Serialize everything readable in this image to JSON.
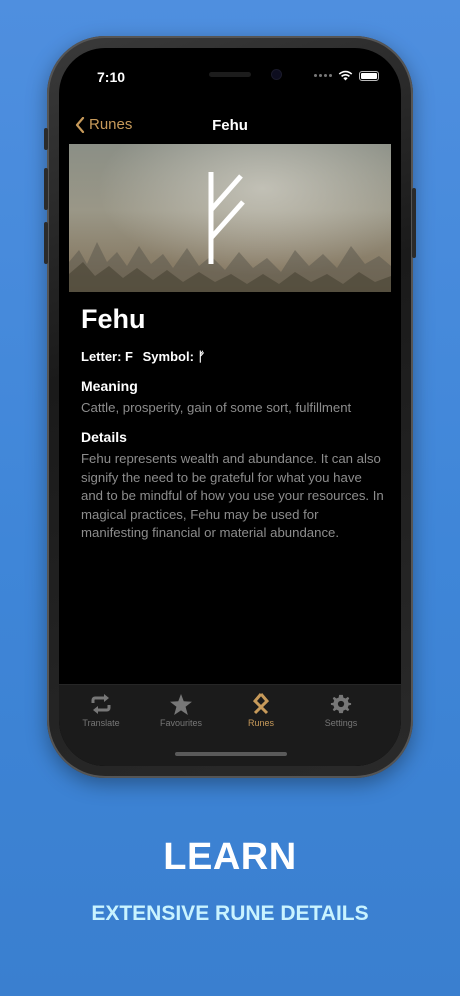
{
  "status": {
    "time": "7:10"
  },
  "nav": {
    "back_label": "Runes",
    "title": "Fehu"
  },
  "rune": {
    "name": "Fehu",
    "letter_label": "Letter: F",
    "symbol_label": "Symbol: ᚠ",
    "meaning_heading": "Meaning",
    "meaning_text": "Cattle, prosperity, gain of some sort, fulfillment",
    "details_heading": "Details",
    "details_text": "Fehu represents wealth and abundance. It can also signify the need to be grateful for what you have and to be mindful of how you use your resources. In magical practices, Fehu may be used for manifesting financial or material abundance."
  },
  "tabs": [
    {
      "label": "Translate",
      "icon": "repeat-icon"
    },
    {
      "label": "Favourites",
      "icon": "star-icon"
    },
    {
      "label": "Runes",
      "icon": "othala-rune-icon",
      "active": true
    },
    {
      "label": "Settings",
      "icon": "gear-icon"
    }
  ],
  "promo": {
    "headline": "LEARN",
    "subline": "EXTENSIVE RUNE DETAILS"
  },
  "colors": {
    "accent": "#c79a5a",
    "background_top": "#4f8fdf",
    "subline": "#c9f3ff"
  }
}
